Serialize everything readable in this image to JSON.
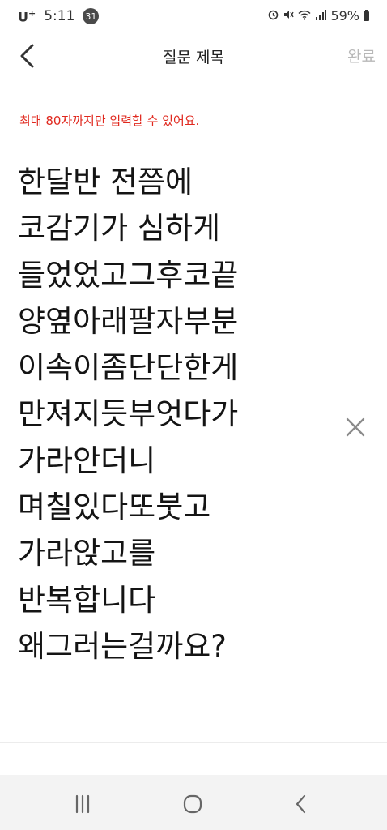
{
  "status_bar": {
    "carrier": "U",
    "carrier_sup": "+",
    "time": "5:11",
    "notification_count": "31",
    "icons": [
      "alarm-clock-icon",
      "mute-icon",
      "wifi-icon",
      "signal-icon"
    ],
    "battery_percent": "59%"
  },
  "header": {
    "title": "질문 제목",
    "done_label": "완료",
    "back_icon": "chevron-left-icon"
  },
  "notice": {
    "text": "최대 80자까지만 입력할 수 있어요."
  },
  "question": {
    "value": "한달반 전쯤에\n코감기가 심하게\n들었었고그후코끝\n양옆아래팔자부분\n이속이좀단단한게\n만져지듯부엇다가\n가라안더니\n며칠있다또붓고\n가라앉고를\n반복합니다\n왜그러는걸까요?"
  },
  "clear_icon": "close-icon",
  "nav": {
    "recents_icon": "recents-icon",
    "home_icon": "home-icon",
    "back_icon": "back-icon"
  },
  "colors": {
    "notice": "#e0281e",
    "done_disabled": "#b8b8b8",
    "nav_bg": "#f3f3f3"
  }
}
